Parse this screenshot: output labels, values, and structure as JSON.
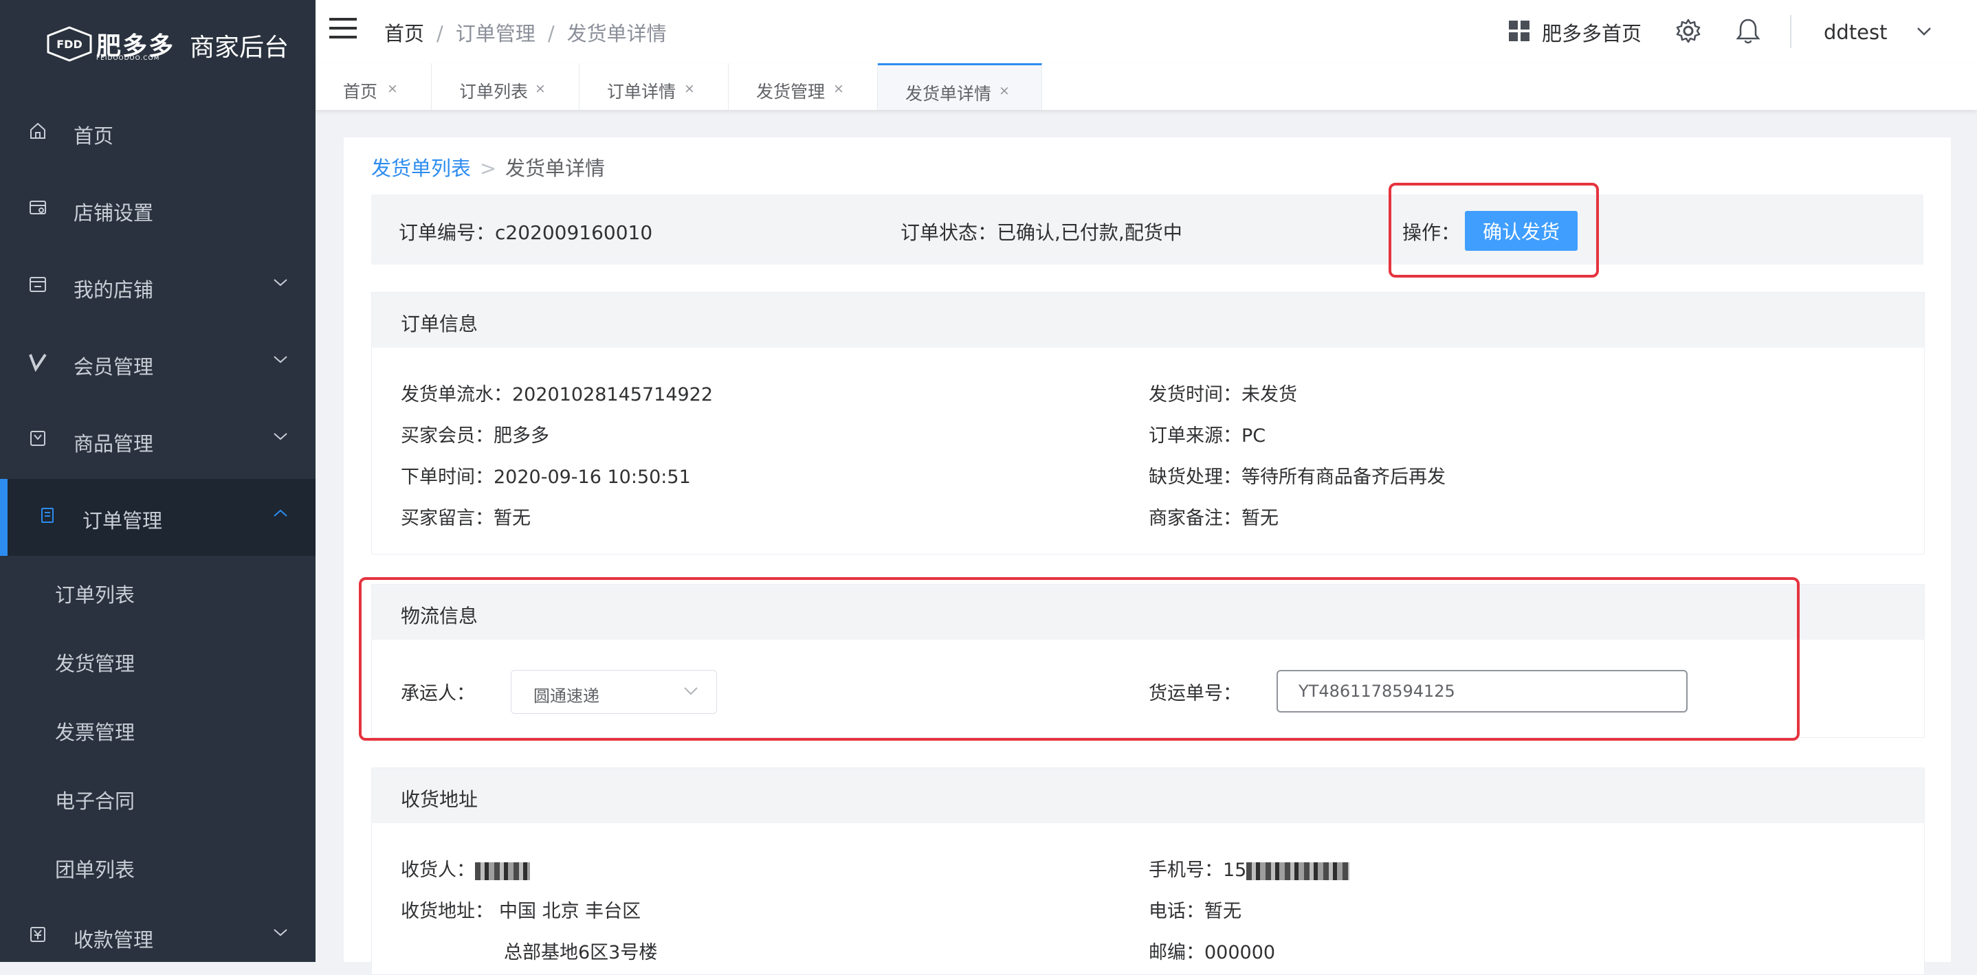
{
  "app": {
    "logo_text": "肥多多",
    "logo_sub": "FEIDOODOO.COM",
    "logo_mark": "FDD",
    "title": "商家后台"
  },
  "sidebar": {
    "items": [
      {
        "label": "首页",
        "icon": "home-icon"
      },
      {
        "label": "店铺设置",
        "icon": "store-icon"
      },
      {
        "label": "我的店铺",
        "icon": "shop-icon"
      },
      {
        "label": "会员管理",
        "icon": "vip-icon"
      },
      {
        "label": "商品管理",
        "icon": "goods-icon"
      },
      {
        "label": "订单管理",
        "icon": "order-icon"
      },
      {
        "label": "收款管理",
        "icon": "payment-icon"
      }
    ],
    "sub_items": [
      "订单列表",
      "发货管理",
      "发票管理",
      "电子合同",
      "团单列表"
    ]
  },
  "header": {
    "breadcrumb": [
      "首页",
      "订单管理",
      "发货单详情"
    ],
    "home_link": "肥多多首页",
    "username": "ddtest"
  },
  "tabs": [
    {
      "label": "首页",
      "close": "×"
    },
    {
      "label": "订单列表",
      "close": "×"
    },
    {
      "label": "订单详情",
      "close": "×"
    },
    {
      "label": "发货管理",
      "close": "×"
    },
    {
      "label": "发货单详情",
      "close": "×"
    }
  ],
  "page": {
    "crumb_parent": "发货单列表",
    "crumb_current": "发货单详情"
  },
  "status_bar": {
    "order_no_label": "订单编号：",
    "order_no": "c202009160010",
    "status_label": "订单状态：",
    "status": "已确认,已付款,配货中",
    "action_label": "操作：",
    "confirm_button": "确认发货"
  },
  "order_info": {
    "title": "订单信息",
    "fields": [
      {
        "label": "发货单流水：",
        "value": "20201028145714922"
      },
      {
        "label": "发货时间：",
        "value": "未发货"
      },
      {
        "label": "买家会员：",
        "value": "肥多多"
      },
      {
        "label": "订单来源：",
        "value": "PC"
      },
      {
        "label": "下单时间：",
        "value": "2020-09-16 10:50:51"
      },
      {
        "label": "缺货处理：",
        "value": "等待所有商品备齐后再发"
      },
      {
        "label": "买家留言：",
        "value": "暂无"
      },
      {
        "label": "商家备注：",
        "value": "暂无"
      }
    ]
  },
  "logistics": {
    "title": "物流信息",
    "carrier_label": "承运人：",
    "carrier_value": "圆通速递",
    "waybill_label": "货运单号：",
    "waybill_value": "YT4861178594125"
  },
  "address": {
    "title": "收货地址",
    "receiver_label": "收货人：",
    "mobile_label": "手机号：",
    "mobile_prefix": "15",
    "addr_label": "收货地址：",
    "addr_line1": "中国 北京 丰台区",
    "addr_line2": "总部基地6区3号楼",
    "phone_label": "电话：",
    "phone_value": "暂无",
    "zip_label": "邮编：",
    "zip_value": "000000"
  },
  "colors": {
    "sidebar_bg": "#29323e",
    "accent": "#2d8cf0",
    "button": "#409eff",
    "highlight_box": "#e5343f"
  }
}
